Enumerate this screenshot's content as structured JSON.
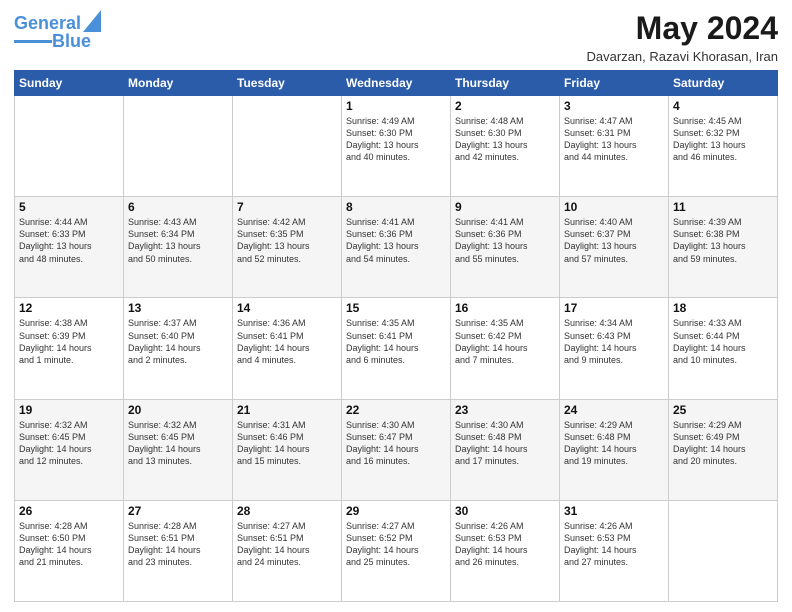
{
  "header": {
    "logo_line1": "General",
    "logo_line2": "Blue",
    "month_year": "May 2024",
    "location": "Davarzan, Razavi Khorasan, Iran"
  },
  "days_of_week": [
    "Sunday",
    "Monday",
    "Tuesday",
    "Wednesday",
    "Thursday",
    "Friday",
    "Saturday"
  ],
  "weeks": [
    [
      {
        "day": "",
        "info": ""
      },
      {
        "day": "",
        "info": ""
      },
      {
        "day": "",
        "info": ""
      },
      {
        "day": "1",
        "info": "Sunrise: 4:49 AM\nSunset: 6:30 PM\nDaylight: 13 hours\nand 40 minutes."
      },
      {
        "day": "2",
        "info": "Sunrise: 4:48 AM\nSunset: 6:30 PM\nDaylight: 13 hours\nand 42 minutes."
      },
      {
        "day": "3",
        "info": "Sunrise: 4:47 AM\nSunset: 6:31 PM\nDaylight: 13 hours\nand 44 minutes."
      },
      {
        "day": "4",
        "info": "Sunrise: 4:45 AM\nSunset: 6:32 PM\nDaylight: 13 hours\nand 46 minutes."
      }
    ],
    [
      {
        "day": "5",
        "info": "Sunrise: 4:44 AM\nSunset: 6:33 PM\nDaylight: 13 hours\nand 48 minutes."
      },
      {
        "day": "6",
        "info": "Sunrise: 4:43 AM\nSunset: 6:34 PM\nDaylight: 13 hours\nand 50 minutes."
      },
      {
        "day": "7",
        "info": "Sunrise: 4:42 AM\nSunset: 6:35 PM\nDaylight: 13 hours\nand 52 minutes."
      },
      {
        "day": "8",
        "info": "Sunrise: 4:41 AM\nSunset: 6:36 PM\nDaylight: 13 hours\nand 54 minutes."
      },
      {
        "day": "9",
        "info": "Sunrise: 4:41 AM\nSunset: 6:36 PM\nDaylight: 13 hours\nand 55 minutes."
      },
      {
        "day": "10",
        "info": "Sunrise: 4:40 AM\nSunset: 6:37 PM\nDaylight: 13 hours\nand 57 minutes."
      },
      {
        "day": "11",
        "info": "Sunrise: 4:39 AM\nSunset: 6:38 PM\nDaylight: 13 hours\nand 59 minutes."
      }
    ],
    [
      {
        "day": "12",
        "info": "Sunrise: 4:38 AM\nSunset: 6:39 PM\nDaylight: 14 hours\nand 1 minute."
      },
      {
        "day": "13",
        "info": "Sunrise: 4:37 AM\nSunset: 6:40 PM\nDaylight: 14 hours\nand 2 minutes."
      },
      {
        "day": "14",
        "info": "Sunrise: 4:36 AM\nSunset: 6:41 PM\nDaylight: 14 hours\nand 4 minutes."
      },
      {
        "day": "15",
        "info": "Sunrise: 4:35 AM\nSunset: 6:41 PM\nDaylight: 14 hours\nand 6 minutes."
      },
      {
        "day": "16",
        "info": "Sunrise: 4:35 AM\nSunset: 6:42 PM\nDaylight: 14 hours\nand 7 minutes."
      },
      {
        "day": "17",
        "info": "Sunrise: 4:34 AM\nSunset: 6:43 PM\nDaylight: 14 hours\nand 9 minutes."
      },
      {
        "day": "18",
        "info": "Sunrise: 4:33 AM\nSunset: 6:44 PM\nDaylight: 14 hours\nand 10 minutes."
      }
    ],
    [
      {
        "day": "19",
        "info": "Sunrise: 4:32 AM\nSunset: 6:45 PM\nDaylight: 14 hours\nand 12 minutes."
      },
      {
        "day": "20",
        "info": "Sunrise: 4:32 AM\nSunset: 6:45 PM\nDaylight: 14 hours\nand 13 minutes."
      },
      {
        "day": "21",
        "info": "Sunrise: 4:31 AM\nSunset: 6:46 PM\nDaylight: 14 hours\nand 15 minutes."
      },
      {
        "day": "22",
        "info": "Sunrise: 4:30 AM\nSunset: 6:47 PM\nDaylight: 14 hours\nand 16 minutes."
      },
      {
        "day": "23",
        "info": "Sunrise: 4:30 AM\nSunset: 6:48 PM\nDaylight: 14 hours\nand 17 minutes."
      },
      {
        "day": "24",
        "info": "Sunrise: 4:29 AM\nSunset: 6:48 PM\nDaylight: 14 hours\nand 19 minutes."
      },
      {
        "day": "25",
        "info": "Sunrise: 4:29 AM\nSunset: 6:49 PM\nDaylight: 14 hours\nand 20 minutes."
      }
    ],
    [
      {
        "day": "26",
        "info": "Sunrise: 4:28 AM\nSunset: 6:50 PM\nDaylight: 14 hours\nand 21 minutes."
      },
      {
        "day": "27",
        "info": "Sunrise: 4:28 AM\nSunset: 6:51 PM\nDaylight: 14 hours\nand 23 minutes."
      },
      {
        "day": "28",
        "info": "Sunrise: 4:27 AM\nSunset: 6:51 PM\nDaylight: 14 hours\nand 24 minutes."
      },
      {
        "day": "29",
        "info": "Sunrise: 4:27 AM\nSunset: 6:52 PM\nDaylight: 14 hours\nand 25 minutes."
      },
      {
        "day": "30",
        "info": "Sunrise: 4:26 AM\nSunset: 6:53 PM\nDaylight: 14 hours\nand 26 minutes."
      },
      {
        "day": "31",
        "info": "Sunrise: 4:26 AM\nSunset: 6:53 PM\nDaylight: 14 hours\nand 27 minutes."
      },
      {
        "day": "",
        "info": ""
      }
    ]
  ]
}
